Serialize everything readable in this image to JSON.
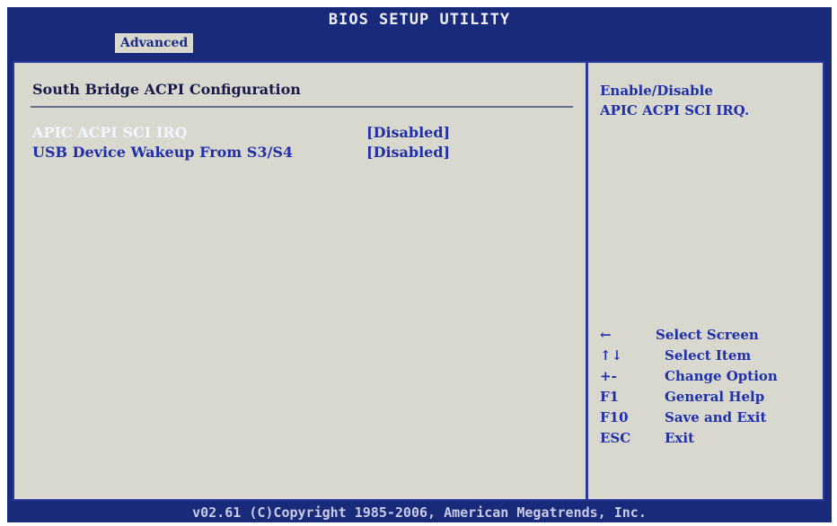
{
  "header": {
    "title": "BIOS SETUP UTILITY",
    "active_tab": "Advanced"
  },
  "main": {
    "section_title": "South Bridge ACPI Configuration",
    "options": [
      {
        "label": "APIC ACPI SCI IRQ",
        "value": "[Disabled]",
        "selected": true
      },
      {
        "label": "USB Device Wakeup From S3/S4",
        "value": "[Disabled]",
        "selected": false
      }
    ]
  },
  "help": {
    "line1": "Enable/Disable",
    "line2": "APIC ACPI SCI IRQ."
  },
  "keys": [
    {
      "key": "←",
      "desc": "Select Screen"
    },
    {
      "key": "↑↓",
      "desc": "Select Item"
    },
    {
      "key": "+-",
      "desc": "Change Option"
    },
    {
      "key": "F1",
      "desc": "General Help"
    },
    {
      "key": "F10",
      "desc": "Save and Exit"
    },
    {
      "key": "ESC",
      "desc": "Exit"
    }
  ],
  "footer": {
    "copyright": "v02.61 (C)Copyright 1985-2006, American Megatrends, Inc."
  },
  "colors": {
    "bios_blue": "#1a2a7a",
    "panel_gray": "#d8d8ce",
    "text_blue": "#2030a8",
    "selected_text": "#f4f4ff"
  }
}
